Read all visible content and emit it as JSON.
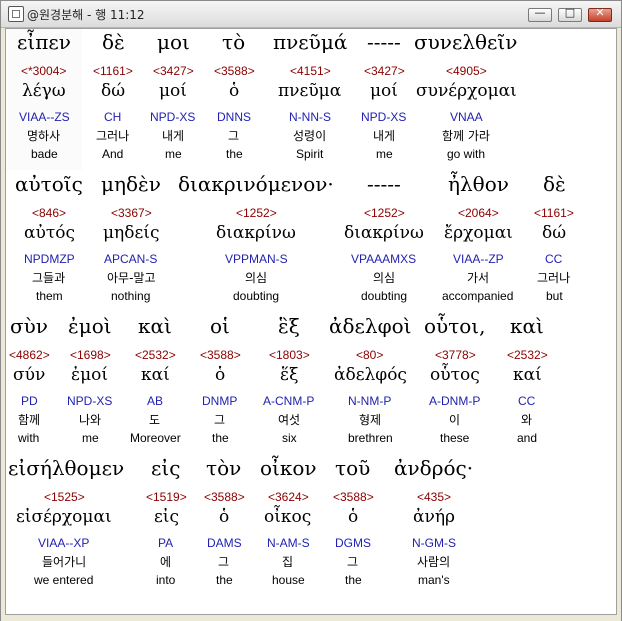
{
  "window": {
    "title": "@원경분해 - 행 11:12",
    "controls": {
      "minimize": "—",
      "maximize": "□",
      "close": "✕"
    }
  },
  "rows": [
    [
      {
        "grk": "εἶπεν",
        "num": "<*3004>",
        "lemma": "λέγω",
        "parse": "VIAA--ZS",
        "kor": "명하사",
        "eng": "bade"
      },
      {
        "grk": "δὲ",
        "num": "<1161>",
        "lemma": "δώ",
        "parse": "CH",
        "kor": "그러나",
        "eng": "And"
      },
      {
        "grk": "μοι",
        "num": "<3427>",
        "lemma": "μοί",
        "parse": "NPD-XS",
        "kor": "내게",
        "eng": "me"
      },
      {
        "grk": "τὸ",
        "num": "<3588>",
        "lemma": "ὁ",
        "parse": "DNNS",
        "kor": "그",
        "eng": "the"
      },
      {
        "grk": "πνεῦμά",
        "num": "<4151>",
        "lemma": "πνεῦμα",
        "parse": "N-NN-S",
        "kor": "성령이",
        "eng": "Spirit"
      },
      {
        "grk": "-----",
        "num": "<3427>",
        "lemma": "μοί",
        "parse": "NPD-XS",
        "kor": "내게",
        "eng": "me"
      },
      {
        "grk": "συνελθεῖν",
        "num": "<4905>",
        "lemma": "συνέρχομαι",
        "parse": "VNAA",
        "kor": "함께 가라",
        "eng": "go with"
      }
    ],
    [
      {
        "grk": "αὐτοῖς",
        "num": "<846>",
        "lemma": "αὐτός",
        "parse": "NPDMZP",
        "kor": "그들과",
        "eng": "them"
      },
      {
        "grk": "μηδὲν",
        "num": "<3367>",
        "lemma": "μηδείς",
        "parse": "APCAN-S",
        "kor": "아무-말고",
        "eng": "nothing"
      },
      {
        "grk": "διακρινόμενον·",
        "num": "<1252>",
        "lemma": "διακρίνω",
        "parse": "VPPMAN-S",
        "kor": "의심",
        "eng": "doubting"
      },
      {
        "grk": "-----",
        "num": "<1252>",
        "lemma": "διακρίνω",
        "parse": "VPAAAMXS",
        "kor": "의심",
        "eng": "doubting"
      },
      {
        "grk": "ἦλθον",
        "num": "<2064>",
        "lemma": "ἔρχομαι",
        "parse": "VIAA--ZP",
        "kor": "가서",
        "eng": "accompanied"
      },
      {
        "grk": "δὲ",
        "num": "<1161>",
        "lemma": "δώ",
        "parse": "CC",
        "kor": "그러나",
        "eng": "but"
      }
    ],
    [
      {
        "grk": "σὺν",
        "num": "<4862>",
        "lemma": "σύν",
        "parse": "PD",
        "kor": "함께",
        "eng": "with"
      },
      {
        "grk": "ἐμοὶ",
        "num": "<1698>",
        "lemma": "ἐμοί",
        "parse": "NPD-XS",
        "kor": "나와",
        "eng": "me"
      },
      {
        "grk": "καὶ",
        "num": "<2532>",
        "lemma": "καί",
        "parse": "AB",
        "kor": "도",
        "eng": "Moreover"
      },
      {
        "grk": "οἱ",
        "num": "<3588>",
        "lemma": "ὁ",
        "parse": "DNMP",
        "kor": "그",
        "eng": "the"
      },
      {
        "grk": "ἓξ",
        "num": "<1803>",
        "lemma": "ἕξ",
        "parse": "A-CNM-P",
        "kor": "여섯",
        "eng": "six"
      },
      {
        "grk": "ἀδελφοὶ",
        "num": "<80>",
        "lemma": "ἀδελφός",
        "parse": "N-NM-P",
        "kor": "형제",
        "eng": "brethren"
      },
      {
        "grk": "οὗτοι,",
        "num": "<3778>",
        "lemma": "οὗτος",
        "parse": "A-DNM-P",
        "kor": "이",
        "eng": "these"
      },
      {
        "grk": "καὶ",
        "num": "<2532>",
        "lemma": "καί",
        "parse": "CC",
        "kor": "와",
        "eng": "and"
      }
    ],
    [
      {
        "grk": "εἰσήλθομεν",
        "num": "<1525>",
        "lemma": "εἰσέρχομαι",
        "parse": "VIAA--XP",
        "kor": "들어가니",
        "eng": "we entered"
      },
      {
        "grk": "εἰς",
        "num": "<1519>",
        "lemma": "εἰς",
        "parse": "PA",
        "kor": "에",
        "eng": "into"
      },
      {
        "grk": "τὸν",
        "num": "<3588>",
        "lemma": "ὁ",
        "parse": "DAMS",
        "kor": "그",
        "eng": "the"
      },
      {
        "grk": "οἶκον",
        "num": "<3624>",
        "lemma": "οἶκος",
        "parse": "N-AM-S",
        "kor": "집",
        "eng": "house"
      },
      {
        "grk": "τοῦ",
        "num": "<3588>",
        "lemma": "ὁ",
        "parse": "DGMS",
        "kor": "그",
        "eng": "the"
      },
      {
        "grk": "ἀνδρός·",
        "num": "<435>",
        "lemma": "ἀνήρ",
        "parse": "N-GM-S",
        "kor": "사람의",
        "eng": "man's"
      }
    ]
  ]
}
